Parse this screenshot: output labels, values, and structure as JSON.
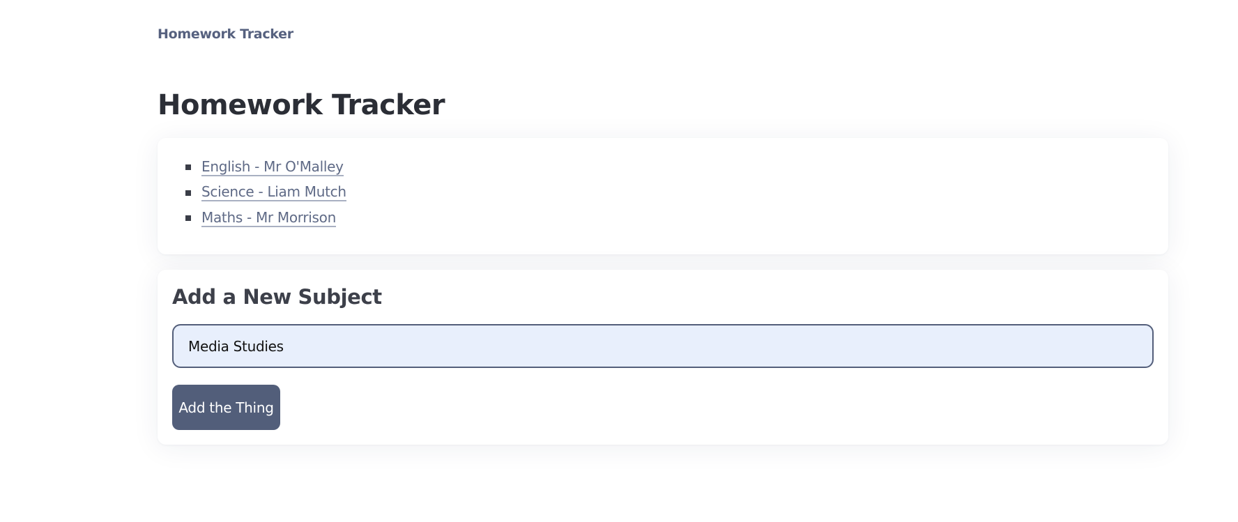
{
  "nav": {
    "brand": "Homework Tracker"
  },
  "page": {
    "title": "Homework Tracker"
  },
  "subjects": [
    {
      "label": "English - Mr O'Malley"
    },
    {
      "label": "Science - Liam Mutch"
    },
    {
      "label": "Maths - Mr Morrison"
    }
  ],
  "add_form": {
    "heading": "Add a New Subject",
    "input_value": "Media Studies",
    "button_label": "Add the Thing"
  }
}
